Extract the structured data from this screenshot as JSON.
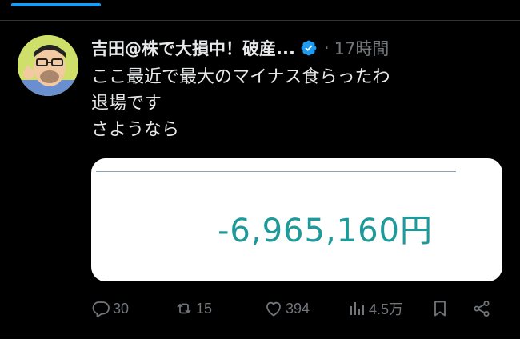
{
  "tweet": {
    "display_name": "吉田@株で大損中！破産...",
    "separator": "·",
    "timestamp": "17時間",
    "text_lines": [
      "ここ最近で最大のマイナス食らったわ",
      "退場です",
      "さようなら"
    ],
    "media": {
      "amount_text": "-6,965,160円"
    }
  },
  "actions": {
    "reply_count": "30",
    "retweet_count": "15",
    "like_count": "394",
    "view_count": "4.5万"
  },
  "icons": {
    "verified": "verified-badge-icon",
    "reply": "reply-icon",
    "retweet": "retweet-icon",
    "like": "heart-icon",
    "views": "views-icon",
    "bookmark": "bookmark-icon",
    "share": "share-icon"
  },
  "colors": {
    "background": "#000000",
    "text": "#e7e9ea",
    "muted": "#71767b",
    "accent": "#1d9bf0",
    "amount": "#1f9a9a"
  }
}
